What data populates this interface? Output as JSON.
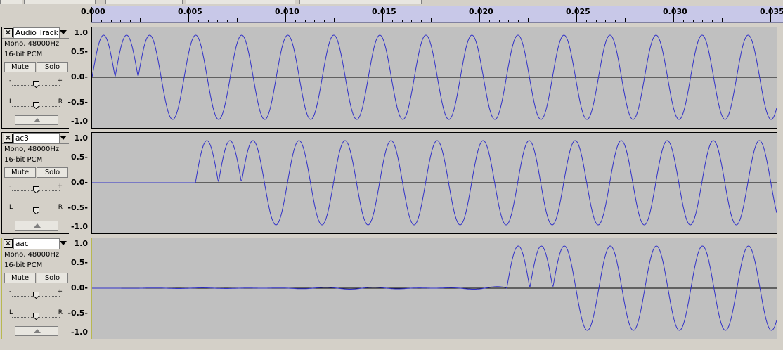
{
  "ruler": {
    "ticks": [
      "0.000",
      "0.005",
      "0.010",
      "0.015",
      "0.020",
      "0.025",
      "0.030",
      "0.035"
    ]
  },
  "colors": {
    "waveform": "#3232c8",
    "track_bg": "#c0c0c0",
    "ruler_bg": "#c8c8e8"
  },
  "amplitude_labels": [
    "1.0",
    "0.5-",
    "0.0-",
    "-0.5-",
    "-1.0"
  ],
  "tracks": [
    {
      "name": "Audio Track",
      "info1": "Mono, 48000Hz",
      "info2": "16-bit PCM",
      "mute_label": "Mute",
      "solo_label": "Solo",
      "gain_minus": "-",
      "gain_plus": "+",
      "pan_left": "L",
      "pan_right": "R"
    },
    {
      "name": "ac3",
      "info1": "Mono, 48000Hz",
      "info2": "16-bit PCM",
      "mute_label": "Mute",
      "solo_label": "Solo",
      "gain_minus": "-",
      "gain_plus": "+",
      "pan_left": "L",
      "pan_right": "R"
    },
    {
      "name": "aac",
      "info1": "Mono, 48000Hz",
      "info2": "16-bit PCM",
      "mute_label": "Mute",
      "solo_label": "Solo",
      "gain_minus": "-",
      "gain_plus": "+",
      "pan_left": "L",
      "pan_right": "R"
    }
  ]
}
